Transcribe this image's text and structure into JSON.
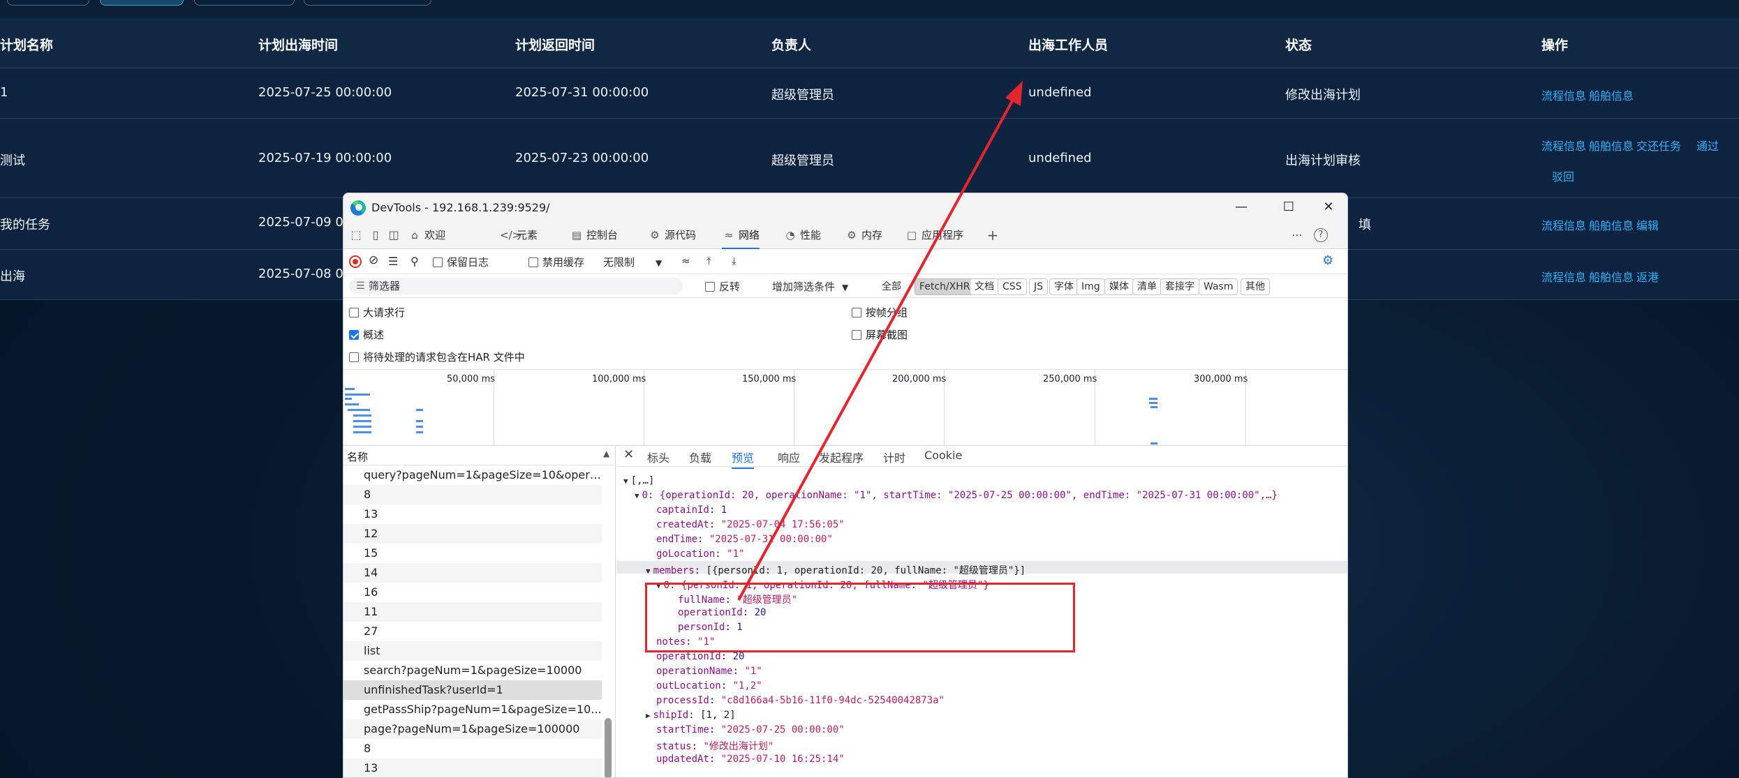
{
  "app": {
    "columns": [
      "计划名称",
      "计划出海时间",
      "计划返回时间",
      "负责人",
      "出海工作人员",
      "状态",
      "操作"
    ],
    "rows": [
      {
        "name": "1",
        "start": "2025-07-25 00:00:00",
        "end": "2025-07-31 00:00:00",
        "owner": "超级管理员",
        "staff": "undefined",
        "status": "修改出海计划",
        "ops": [
          "流程信息",
          "船舶信息"
        ]
      },
      {
        "name": "测试",
        "start": "2025-07-19 00:00:00",
        "end": "2025-07-23 00:00:00",
        "owner": "超级管理员",
        "staff": "undefined",
        "status": "出海计划审核",
        "ops": [
          "流程信息",
          "船舶信息",
          "交还任务",
          "通过",
          "驳回"
        ]
      },
      {
        "name": "我的任务",
        "start": "2025-07-09 00",
        "status": "填",
        "ops": [
          "流程信息",
          "船舶信息",
          "编辑"
        ]
      },
      {
        "name": "出海",
        "start": "2025-07-08 00",
        "ops": [
          "流程信息",
          "船舶信息",
          "返港"
        ]
      }
    ]
  },
  "devtools": {
    "title": "DevTools - 192.168.1.239:9529/",
    "tabs": [
      "欢迎",
      "元素",
      "控制台",
      "源代码",
      "网络",
      "性能",
      "内存",
      "应用程序"
    ],
    "toolbar": {
      "preserve_log": "保留日志",
      "disable_cache": "禁用缓存",
      "throttle": "无限制"
    },
    "filter": {
      "placeholder": "筛选器",
      "invert": "反转",
      "more_filters": "增加筛选条件"
    },
    "type_chips": [
      "全部",
      "Fetch/XHR",
      "文档",
      "CSS",
      "JS",
      "字体",
      "Img",
      "媒体",
      "清单",
      "套接字",
      "Wasm",
      "其他"
    ],
    "options": {
      "big_rows": "大请求行",
      "group_by_frame": "按帧分组",
      "overview": "概述",
      "screenshots": "屏幕截图",
      "har": "将待处理的请求包含在HAR 文件中"
    },
    "timeline_labels": [
      "50,000 ms",
      "100,000 ms",
      "150,000 ms",
      "200,000 ms",
      "250,000 ms",
      "300,000 ms"
    ],
    "name_header": "名称",
    "requests": [
      "query?pageNum=1&pageSize=10&operationName=...",
      "8",
      "13",
      "12",
      "15",
      "14",
      "16",
      "11",
      "27",
      "list",
      "search?pageNum=1&pageSize=10000",
      "unfinishedTask?userId=1",
      "getPassShip?pageNum=1&pageSize=10...",
      "page?pageNum=1&pageSize=100000",
      "8",
      "13"
    ],
    "detail_tabs": [
      "标头",
      "负载",
      "预览",
      "响应",
      "发起程序",
      "计时",
      "Cookie"
    ],
    "preview": {
      "root": "[,…]",
      "item0_summary": "0: {operationId: 20, operationName: \"1\", startTime: \"2025-07-25 00:00:00\", endTime: \"2025-07-31 00:00:00\",…}",
      "fields": [
        {
          "key": "captainId",
          "value": "1",
          "type": "n"
        },
        {
          "key": "createdAt",
          "value": "\"2025-07-04 17:56:05\"",
          "type": "s"
        },
        {
          "key": "endTime",
          "value": "\"2025-07-31 00:00:00\"",
          "type": "s"
        },
        {
          "key": "goLocation",
          "value": "\"1\"",
          "type": "s"
        }
      ],
      "members_summary": "[{personId: 1, operationId: 20, fullName: \"超级管理员\"}]",
      "member0_summary": "0: {personId: 1, operationId: 20, fullName: \"超级管理员\"}",
      "member_fields": [
        {
          "key": "fullName",
          "value": "\"超级管理员\"",
          "type": "s"
        },
        {
          "key": "operationId",
          "value": "20",
          "type": "n"
        },
        {
          "key": "personId",
          "value": "1",
          "type": "n"
        }
      ],
      "fields2": [
        {
          "key": "notes",
          "value": "\"1\"",
          "type": "s"
        },
        {
          "key": "operationId",
          "value": "20",
          "type": "n"
        },
        {
          "key": "operationName",
          "value": "\"1\"",
          "type": "s"
        },
        {
          "key": "outLocation",
          "value": "\"1,2\"",
          "type": "s"
        },
        {
          "key": "processId",
          "value": "\"c8d166a4-5b16-11f0-94dc-52540042873a\"",
          "type": "s"
        }
      ],
      "shipId_summary": "[1, 2]",
      "fields3": [
        {
          "key": "startTime",
          "value": "\"2025-07-25 00:00:00\"",
          "type": "s"
        },
        {
          "key": "status",
          "value": "\"修改出海计划\"",
          "type": "s"
        },
        {
          "key": "updatedAt",
          "value": "\"2025-07-10 16:25:14\"",
          "type": "s"
        }
      ]
    }
  },
  "colors": {
    "accent": "#1a73e8",
    "annotation": "#e3262c",
    "link": "#2fb3ff"
  }
}
